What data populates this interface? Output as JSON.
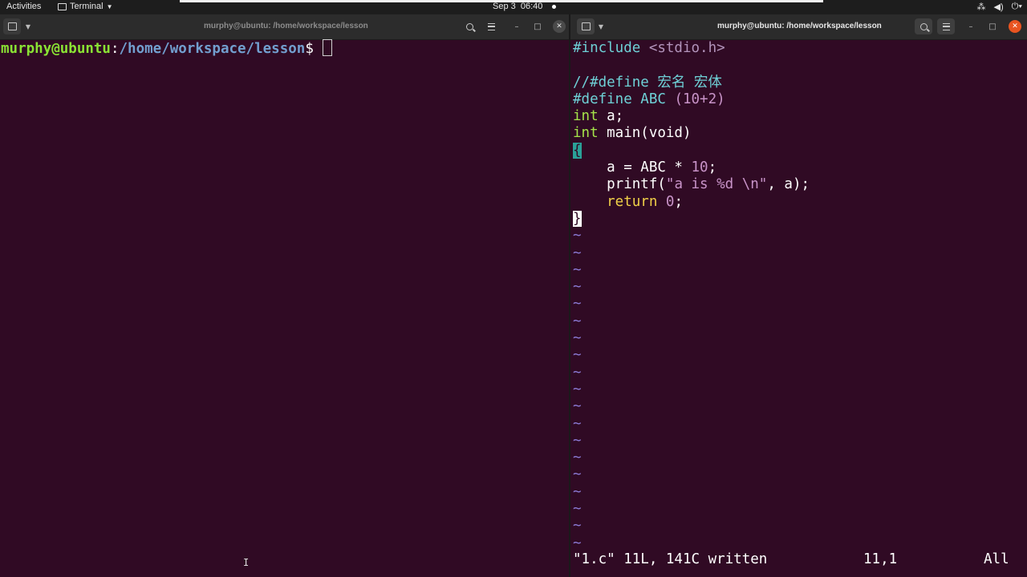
{
  "topbar": {
    "activities": "Activities",
    "app_name": "Terminal",
    "clock": "Sep 3  06:40",
    "tray_icons": [
      "network-icon",
      "volume-icon",
      "power-icon"
    ]
  },
  "left_window": {
    "title": "murphy@ubuntu: /home/workspace/lesson",
    "prompt_user": "murphy@ubuntu",
    "prompt_sep": ":",
    "prompt_path": "/home/workspace/lesson",
    "prompt_symbol": "$"
  },
  "right_window": {
    "title": "murphy@ubuntu: /home/workspace/lesson",
    "code": {
      "line1_pp": "#include ",
      "line1_hdr": "<stdio.h>",
      "line3": "//#define 宏名 宏体",
      "line4_pp": "#define ABC ",
      "line4_val": "(10+2)",
      "line5_kw": "int",
      "line5_rest": " a;",
      "line6_kw": "int",
      "line6_rest": " main(void)",
      "line7": "{",
      "line8_a": "    a = ABC * ",
      "line8_num": "10",
      "line8_b": ";",
      "line9_a": "    printf(",
      "line9_str": "\"a is %d \\n\"",
      "line9_b": ", a);",
      "line10_kw": "    return",
      "line10_sp": " ",
      "line10_num": "0",
      "line10_b": ";",
      "line11": "}"
    },
    "tilde": "~",
    "status_msg": "\"1.c\" 11L, 141C written",
    "status_pos": "11,1",
    "status_scroll": "All"
  },
  "colors": {
    "background": "#300a24",
    "prompt_user": "#8ae234",
    "prompt_path": "#729fcf",
    "close_button": "#e95420"
  }
}
